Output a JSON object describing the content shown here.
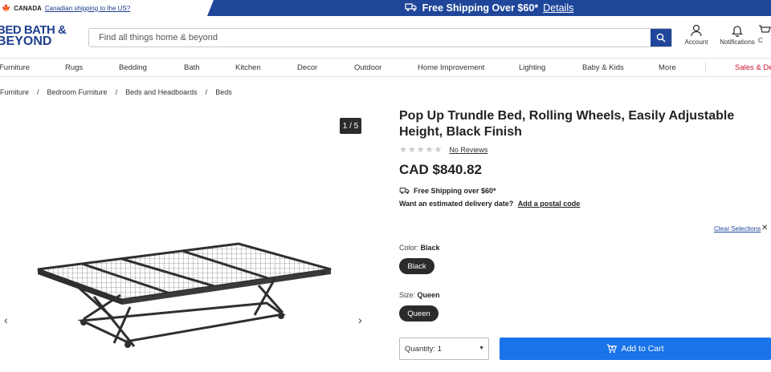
{
  "topbar": {
    "country": "CANADA",
    "shipping_link": "Canadian shipping to the US?",
    "promo_text": "Free Shipping Over $60*",
    "promo_link": "Details",
    "promo_color": "#1f4699"
  },
  "header": {
    "logo_line1": "BED BATH &",
    "logo_line2": "BEYOND",
    "search_placeholder": "Find all things home & beyond",
    "account_label": "Account",
    "notifications_label": "Notifications",
    "cart_label": "C"
  },
  "nav": {
    "items": [
      "Furniture",
      "Rugs",
      "Bedding",
      "Bath",
      "Kitchen",
      "Decor",
      "Outdoor",
      "Home Improvement",
      "Lighting",
      "Baby & Kids",
      "More"
    ],
    "sales": "Sales & De"
  },
  "breadcrumb": [
    "Furniture",
    "/",
    "Bedroom Furniture",
    "/",
    "Beds and Headboards",
    "/",
    "Beds"
  ],
  "gallery": {
    "counter": "1 / 5",
    "prev": "‹",
    "next": "›"
  },
  "product": {
    "title": "Pop Up Trundle Bed, Rolling Wheels, Easily Adjustable Height, Black Finish",
    "reviews": "No Reviews",
    "rating_stars": 0,
    "price": "CAD $840.82",
    "shipping": "Free Shipping over $60*",
    "delivery_question": "Want an estimated delivery date?",
    "postal_link": "Add a postal code",
    "clear_selections": "Clear Selections",
    "clear_x": "✕",
    "color_label": "Color:",
    "color_value": "Black",
    "color_option": "Black",
    "size_label": "Size:",
    "size_value": "Queen",
    "size_option": "Queen",
    "quantity": "Quantity: 1",
    "add_to_cart": "Add to Cart",
    "cart_button_color": "#1a73e8"
  }
}
